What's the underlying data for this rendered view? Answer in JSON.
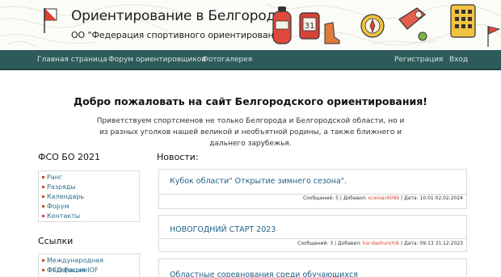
{
  "header": {
    "title": "Ориентирование в Белгороде",
    "subtitle": "ОО \"Федерация спортивного ориентирования\"",
    "compass_badge": "31"
  },
  "nav": {
    "left": [
      "Главная страница",
      "Форум ориентировщиков",
      "Фотогалерея"
    ],
    "right": [
      "Регистрация",
      "Вход"
    ]
  },
  "welcome": {
    "title": "Добро пожаловать на сайт Белгородского ориентирования!",
    "text": "Приветствуем спортсменов не только Белгорода и Белгородской области, но и из разных уголков нашей великой и необъятной родины, а также ближнего и дальнего зарубежья."
  },
  "sidebar": {
    "fso_title": "ФСО БО 2021",
    "fso_items": [
      "Ранг",
      "Разряды",
      "Календарь",
      "Форум",
      "Контакты"
    ],
    "links_title": "Ссылки",
    "links_items": [
      "Международная Федерация IOF",
      "ФСО России",
      ""
    ]
  },
  "news": {
    "title": "Новости:",
    "items": [
      {
        "headline": "Кубок области\" Открытие зимнего сезона\".",
        "messages_label": "Сообщений: 5",
        "added_label": "Добавил:",
        "user": "ксеnіас6089",
        "date": "Дата: 10:01 02.02.2024"
      },
      {
        "headline": "НОВОГОДНИЙ СТАРТ 2023",
        "messages_label": "Сообщений: 3",
        "added_label": "Добавил:",
        "user": "ksr-dashunchik",
        "date": "Дата: 09:13 31.12.2023"
      },
      {
        "headline": "Областные соревнования среди обучающихся",
        "messages_label": "",
        "added_label": "",
        "user": "",
        "date": ""
      }
    ]
  },
  "colors": {
    "nav_bg": "#2f5a5a",
    "link": "#1f5f87",
    "accent_red": "#d0442f",
    "bullet": "#c94a2e"
  }
}
